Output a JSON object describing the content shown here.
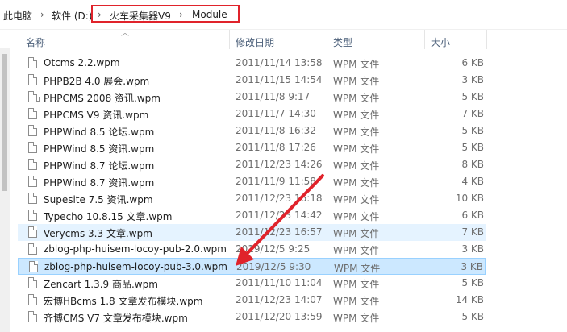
{
  "address_bar": {
    "crumbs": [
      "此电脑",
      "软件 (D:)",
      "火车采集器V9",
      "Module"
    ],
    "separator": "›"
  },
  "columns": {
    "name": "名称",
    "modified": "修改日期",
    "type": "类型",
    "size": "大小"
  },
  "files": [
    {
      "name": "Otcms 2.2.wpm",
      "date": "2011/11/14 13:58",
      "type": "WPM 文件",
      "size": "6 KB"
    },
    {
      "name": "PHPB2B 4.0 展会.wpm",
      "date": "2011/11/15 14:54",
      "type": "WPM 文件",
      "size": "3 KB"
    },
    {
      "name": "PHPCMS 2008 资讯.wpm",
      "date": "2011/11/8 9:17",
      "type": "WPM 文件",
      "size": "5 KB"
    },
    {
      "name": "PHPCMS V9 资讯.wpm",
      "date": "2011/11/7 14:30",
      "type": "WPM 文件",
      "size": "7 KB"
    },
    {
      "name": "PHPWind 8.5 论坛.wpm",
      "date": "2011/11/8 16:32",
      "type": "WPM 文件",
      "size": "5 KB"
    },
    {
      "name": "PHPWind 8.5 资讯.wpm",
      "date": "2011/11/8 17:26",
      "type": "WPM 文件",
      "size": "5 KB"
    },
    {
      "name": "PHPWind 8.7 论坛.wpm",
      "date": "2011/12/23 14:26",
      "type": "WPM 文件",
      "size": "8 KB"
    },
    {
      "name": "PHPWind 8.7 资讯.wpm",
      "date": "2011/11/9 11:58",
      "type": "WPM 文件",
      "size": "4 KB"
    },
    {
      "name": "Supesite 7.5 资讯.wpm",
      "date": "2011/12/23 16:18",
      "type": "WPM 文件",
      "size": "10 KB"
    },
    {
      "name": "Typecho 10.8.15 文章.wpm",
      "date": "2011/12/23 14:42",
      "type": "WPM 文件",
      "size": "6 KB"
    },
    {
      "name": "Verycms 3.3 文章.wpm",
      "date": "2011/12/23 16:57",
      "type": "WPM 文件",
      "size": "7 KB"
    },
    {
      "name": "zblog-php-huisem-locoy-pub-2.0.wpm",
      "date": "2019/12/5 9:25",
      "type": "WPM 文件",
      "size": "3 KB"
    },
    {
      "name": "zblog-php-huisem-locoy-pub-3.0.wpm",
      "date": "2019/12/5 9:30",
      "type": "WPM 文件",
      "size": "3 KB"
    },
    {
      "name": "Zencart 1.3.9 商品.wpm",
      "date": "2011/11/10 11:04",
      "type": "WPM 文件",
      "size": "5 KB"
    },
    {
      "name": "宏博HBcms 1.8 文章发布模块.wpm",
      "date": "2011/12/23 14:07",
      "type": "WPM 文件",
      "size": "14 KB"
    },
    {
      "name": "齐博CMS V7 文章发布模块.wpm",
      "date": "2011/12/20 13:59",
      "type": "WPM 文件",
      "size": "5 KB"
    }
  ],
  "hover_index": 10,
  "selected_index": 12,
  "colors": {
    "annotation_red": "#e0232b",
    "selected": "#cce8ff",
    "hover": "#e5f3ff"
  },
  "icons": {
    "file": "file-icon",
    "sort": "sort-up-icon",
    "separator": "chevron-right-icon"
  }
}
